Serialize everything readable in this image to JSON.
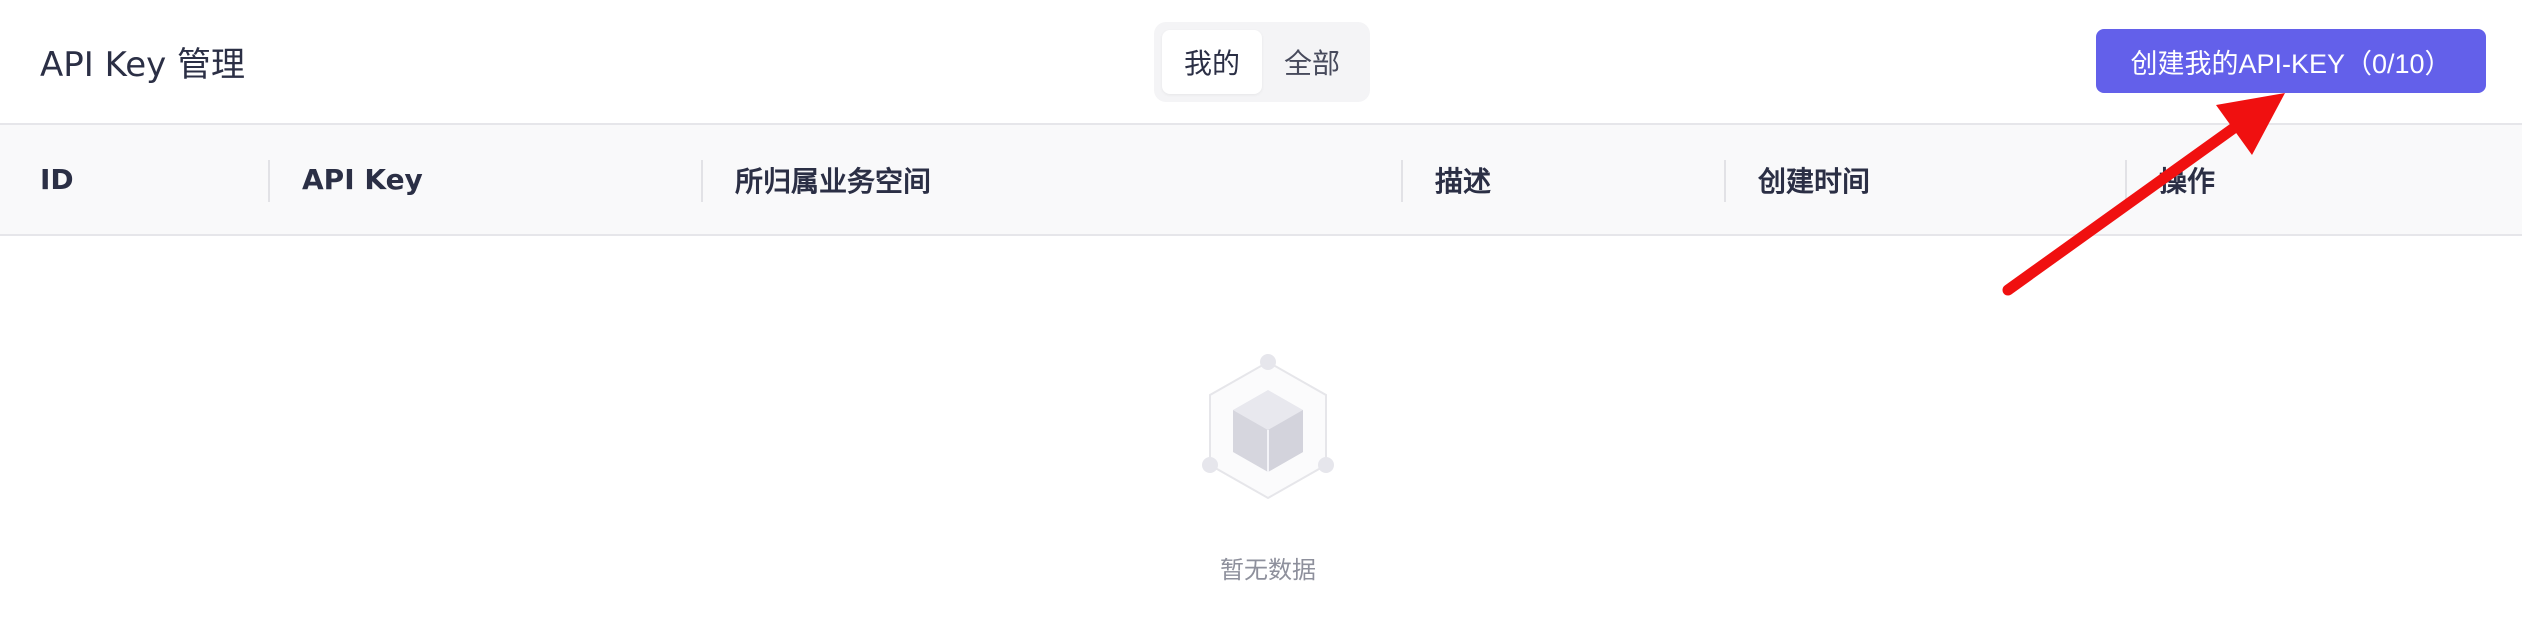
{
  "header": {
    "title": "API Key 管理",
    "tabs": [
      {
        "label": "我的",
        "active": true
      },
      {
        "label": "全部",
        "active": false
      }
    ],
    "create_button_label": "创建我的API-KEY（0/10）"
  },
  "table": {
    "columns": [
      "ID",
      "API Key",
      "所归属业务空间",
      "描述",
      "创建时间",
      "操作"
    ],
    "rows": []
  },
  "empty_state": {
    "icon": "empty-box-icon",
    "text": "暂无数据"
  },
  "annotation": {
    "icon": "red-arrow-icon",
    "color": "#f01010"
  },
  "colors": {
    "accent": "#6360ea",
    "header_bg": "#f9f9fa",
    "text": "#2b2f45"
  }
}
